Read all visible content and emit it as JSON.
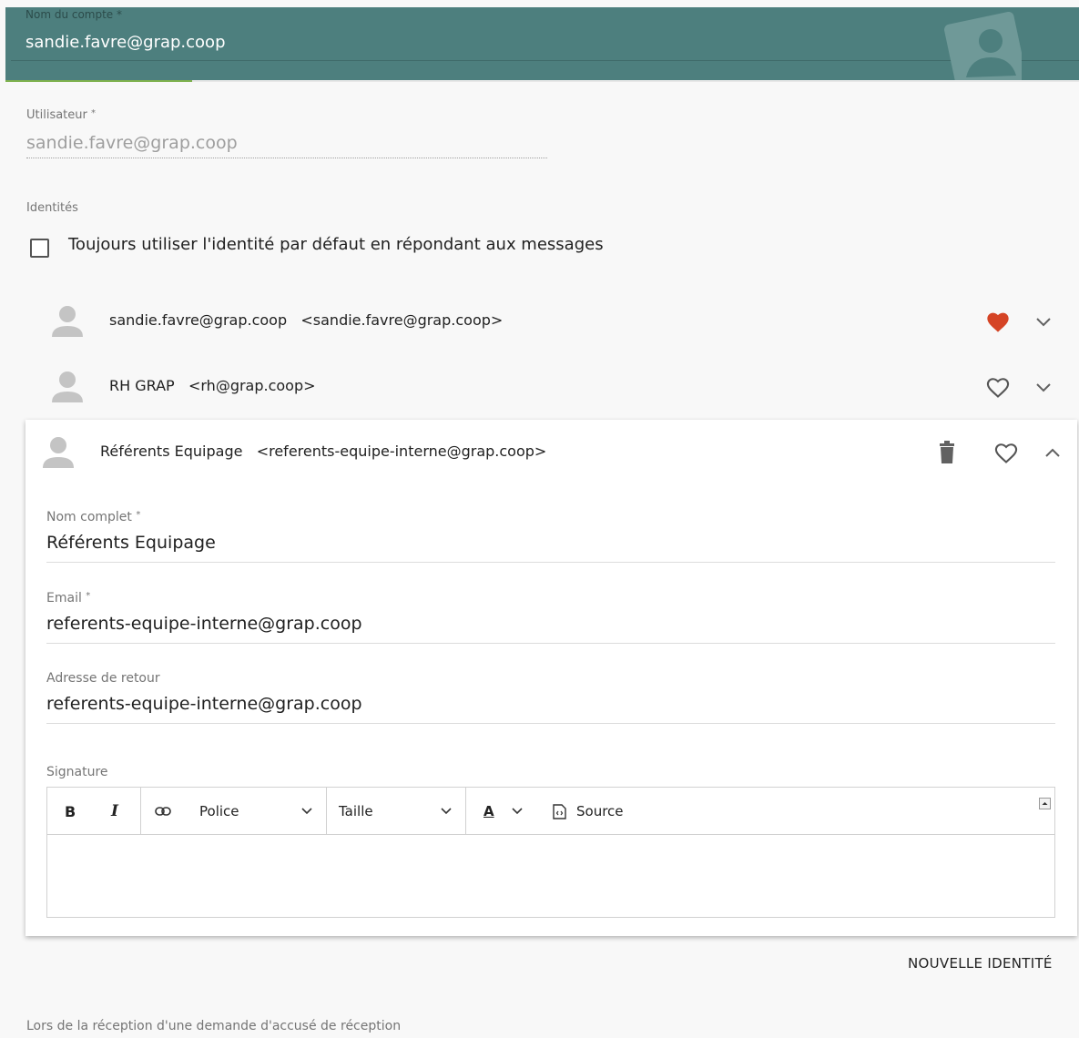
{
  "account": {
    "label": "Nom du compte",
    "required_mark": "*",
    "value": "sandie.favre@grap.coop"
  },
  "user": {
    "label": "Utilisateur",
    "required_mark": "*",
    "value": "sandie.favre@grap.coop"
  },
  "identities": {
    "section_label": "Identités",
    "always_default_label": "Toujours utiliser l'identité par défaut en répondant aux messages",
    "always_default_checked": false,
    "items": [
      {
        "name": "sandie.favre@grap.coop",
        "email": "<sandie.favre@grap.coop>",
        "favorite": true
      },
      {
        "name": "RH GRAP",
        "email": "<rh@grap.coop>",
        "favorite": false
      },
      {
        "name": "Référents Equipage",
        "email": "<referents-equipe-interne@grap.coop>",
        "favorite": false,
        "expanded": true
      }
    ]
  },
  "edit": {
    "fullname_label": "Nom complet",
    "fullname_value": "Référents Equipage",
    "email_label": "Email",
    "email_value": "referents-equipe-interne@grap.coop",
    "reply_label": "Adresse de retour",
    "reply_value": "referents-equipe-interne@grap.coop",
    "signature_label": "Signature",
    "required_mark": "*"
  },
  "toolbar": {
    "bold": "B",
    "italic": "I",
    "font_label": "Police",
    "size_label": "Taille",
    "color_label": "A",
    "source_label": "Source"
  },
  "new_identity_label": "NOUVELLE IDENTITÉ",
  "receipt_label": "Lors de la réception d'une demande d'accusé de réception",
  "colors": {
    "header_bg": "#4d7f7e",
    "accent_green": "#7fb24f",
    "favorite_red": "#d54425"
  }
}
